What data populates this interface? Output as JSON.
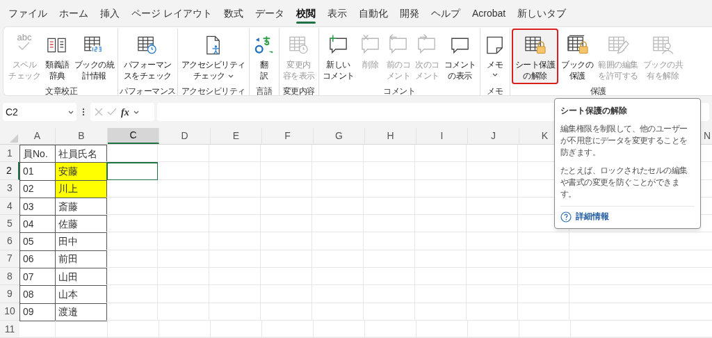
{
  "menu_tabs": [
    {
      "label": "ファイル",
      "selected": false
    },
    {
      "label": "ホーム",
      "selected": false
    },
    {
      "label": "挿入",
      "selected": false
    },
    {
      "label": "ページ レイアウト",
      "selected": false
    },
    {
      "label": "数式",
      "selected": false
    },
    {
      "label": "データ",
      "selected": false
    },
    {
      "label": "校閲",
      "selected": true
    },
    {
      "label": "表示",
      "selected": false
    },
    {
      "label": "自動化",
      "selected": false
    },
    {
      "label": "開発",
      "selected": false
    },
    {
      "label": "ヘルプ",
      "selected": false
    },
    {
      "label": "Acrobat",
      "selected": false
    },
    {
      "label": "新しいタブ",
      "selected": false
    }
  ],
  "ribbon_groups": [
    {
      "label": "文章校正",
      "buttons": [
        {
          "kind": "spell",
          "icon_text": "abc",
          "label": [
            "スペル",
            "チェック"
          ],
          "disabled": true,
          "dropdown": false,
          "outlined": false
        },
        {
          "kind": "book",
          "label": [
            "類義語",
            "辞典"
          ],
          "disabled": false,
          "dropdown": false,
          "outlined": false
        },
        {
          "kind": "stats",
          "label": [
            "ブックの統",
            "計情報"
          ],
          "disabled": false,
          "dropdown": false,
          "outlined": false
        }
      ]
    },
    {
      "label": "パフォーマンス",
      "buttons": [
        {
          "kind": "timer",
          "label": [
            "パフォーマン",
            "スをチェック"
          ],
          "disabled": false,
          "dropdown": false,
          "outlined": false
        }
      ]
    },
    {
      "label": "アクセシビリティ",
      "buttons": [
        {
          "kind": "access",
          "label": [
            "アクセシビリティ",
            "チェック"
          ],
          "disabled": false,
          "dropdown": true,
          "outlined": false
        }
      ]
    },
    {
      "label": "言語",
      "buttons": [
        {
          "kind": "translate",
          "label": [
            "翻",
            "訳"
          ],
          "disabled": false,
          "dropdown": false,
          "outlined": false
        }
      ]
    },
    {
      "label": "変更内容",
      "buttons": [
        {
          "kind": "history",
          "label": [
            "変更内",
            "容を表示"
          ],
          "disabled": true,
          "dropdown": false,
          "outlined": false
        }
      ]
    },
    {
      "label": "コメント",
      "buttons": [
        {
          "kind": "comment_new",
          "label": [
            "新しい",
            "コメント"
          ],
          "disabled": false,
          "dropdown": false,
          "outlined": false
        },
        {
          "kind": "comment_delete",
          "label": [
            "削除"
          ],
          "disabled": true,
          "dropdown": false,
          "outlined": false
        },
        {
          "kind": "comment_prev",
          "label": [
            "前のコ",
            "メント"
          ],
          "disabled": true,
          "dropdown": false,
          "outlined": false
        },
        {
          "kind": "comment_next",
          "label": [
            "次のコ",
            "メント"
          ],
          "disabled": true,
          "dropdown": false,
          "outlined": false
        },
        {
          "kind": "comment",
          "label": [
            "コメント",
            "の表示"
          ],
          "disabled": false,
          "dropdown": false,
          "outlined": false
        }
      ]
    },
    {
      "label": "メモ",
      "buttons": [
        {
          "kind": "note",
          "label": [
            "メモ"
          ],
          "disabled": false,
          "dropdown": true,
          "outlined": false
        }
      ]
    },
    {
      "label": "保護",
      "buttons": [
        {
          "kind": "sheet_lock",
          "label": [
            "シート保護",
            "の解除"
          ],
          "disabled": false,
          "dropdown": false,
          "outlined": true
        },
        {
          "kind": "book_lock",
          "label": [
            "ブックの",
            "保護"
          ],
          "disabled": false,
          "dropdown": false,
          "outlined": false
        },
        {
          "kind": "range_edit",
          "label": [
            "範囲の編集",
            "を許可する"
          ],
          "disabled": true,
          "dropdown": false,
          "outlined": false
        },
        {
          "kind": "share",
          "label": [
            "ブックの共",
            "有を解除"
          ],
          "disabled": true,
          "dropdown": false,
          "outlined": false
        }
      ]
    }
  ],
  "formula_bar": {
    "name_box": "C2",
    "fx": "fx"
  },
  "columns": [
    {
      "label": "A",
      "selected": false
    },
    {
      "label": "B",
      "selected": false
    },
    {
      "label": "C",
      "selected": true
    },
    {
      "label": "D",
      "selected": false
    },
    {
      "label": "E",
      "selected": false
    },
    {
      "label": "F",
      "selected": false
    },
    {
      "label": "G",
      "selected": false
    },
    {
      "label": "H",
      "selected": false
    },
    {
      "label": "I",
      "selected": false
    },
    {
      "label": "J",
      "selected": false
    },
    {
      "label": "K",
      "selected": false
    },
    {
      "label": "N",
      "selected": false
    }
  ],
  "rows": [
    {
      "header": "1",
      "selected": false,
      "cells": [
        {
          "text": "員No.",
          "highlighted": false
        },
        {
          "text": "社員氏名",
          "highlighted": false
        }
      ]
    },
    {
      "header": "2",
      "selected": true,
      "cells": [
        {
          "text": "01",
          "highlighted": false
        },
        {
          "text": "安藤",
          "highlighted": true
        }
      ]
    },
    {
      "header": "3",
      "selected": false,
      "cells": [
        {
          "text": "02",
          "highlighted": false
        },
        {
          "text": "川上",
          "highlighted": true
        }
      ]
    },
    {
      "header": "4",
      "selected": false,
      "cells": [
        {
          "text": "03",
          "highlighted": false
        },
        {
          "text": "斎藤",
          "highlighted": false
        }
      ]
    },
    {
      "header": "5",
      "selected": false,
      "cells": [
        {
          "text": "04",
          "highlighted": false
        },
        {
          "text": "佐藤",
          "highlighted": false
        }
      ]
    },
    {
      "header": "6",
      "selected": false,
      "cells": [
        {
          "text": "05",
          "highlighted": false
        },
        {
          "text": "田中",
          "highlighted": false
        }
      ]
    },
    {
      "header": "7",
      "selected": false,
      "cells": [
        {
          "text": "06",
          "highlighted": false
        },
        {
          "text": "前田",
          "highlighted": false
        }
      ]
    },
    {
      "header": "8",
      "selected": false,
      "cells": [
        {
          "text": "07",
          "highlighted": false
        },
        {
          "text": "山田",
          "highlighted": false
        }
      ]
    },
    {
      "header": "9",
      "selected": false,
      "cells": [
        {
          "text": "08",
          "highlighted": false
        },
        {
          "text": "山本",
          "highlighted": false
        }
      ]
    },
    {
      "header": "10",
      "selected": false,
      "cells": [
        {
          "text": "09",
          "highlighted": false
        },
        {
          "text": "渡邉",
          "highlighted": false
        }
      ]
    },
    {
      "header": "11",
      "selected": false,
      "cells": []
    }
  ],
  "tooltip": {
    "title": "シート保護の解除",
    "paragraphs": [
      "編集権限を制限して、他のユーザーが不用意にデータを変更することを防ぎます。",
      "たとえば、ロックされたセルの編集や書式の変更を防ぐことができます。"
    ],
    "link": "詳細情報"
  }
}
